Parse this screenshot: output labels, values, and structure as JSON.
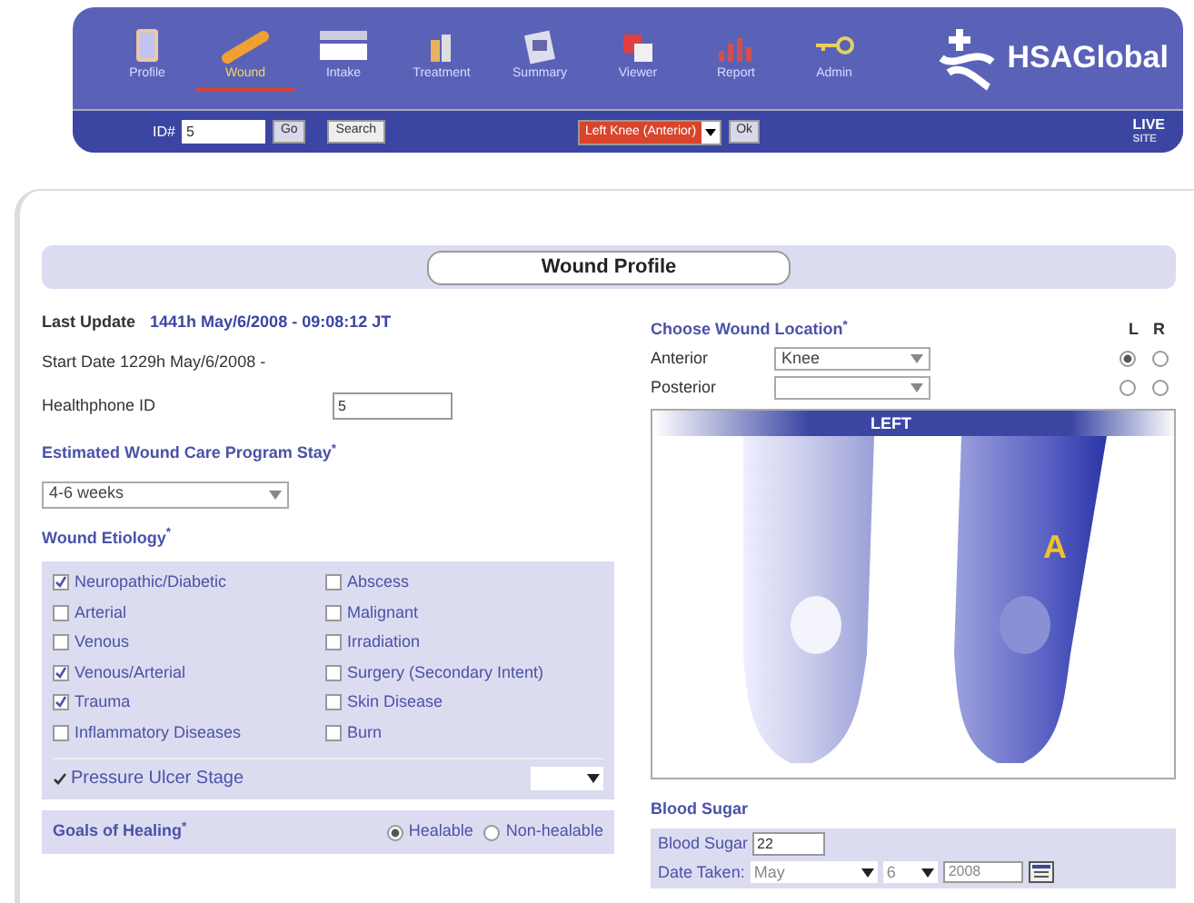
{
  "nav": {
    "items": [
      {
        "label": "Profile",
        "selected": false
      },
      {
        "label": "Wound",
        "selected": true
      },
      {
        "label": "Intake",
        "selected": false
      },
      {
        "label": "Treatment",
        "selected": false
      },
      {
        "label": "Summary",
        "selected": false
      },
      {
        "label": "Viewer",
        "selected": false
      },
      {
        "label": "Report",
        "selected": false
      },
      {
        "label": "Admin",
        "selected": false
      }
    ],
    "brand": "HSAGlobal"
  },
  "toolbar": {
    "id_label": "ID#",
    "id_value": "5",
    "go": "Go",
    "search": "Search",
    "location": "Left Knee (Anterior)",
    "ok": "Ok",
    "site_badge": [
      "LIVE",
      "SITE"
    ]
  },
  "title": "Wound Profile",
  "last_update": {
    "label": "Last Update",
    "value": "1441h May/6/2008 - 09:08:12 JT"
  },
  "start_date": "Start Date 1229h May/6/2008 -",
  "healthphone": {
    "label": "Healthphone ID",
    "value": "5"
  },
  "program_stay": {
    "label": "Estimated Wound Care Program Stay$^{*}$",
    "value": "4-6 weeks"
  },
  "etiology": {
    "label": "Wound Etiology$^{*}$",
    "items": [
      {
        "label": "Neuropathic/Diabetic",
        "checked": true
      },
      {
        "label": "Abscess",
        "checked": false
      },
      {
        "label": "Arterial",
        "checked": false
      },
      {
        "label": "Malignant",
        "checked": false
      },
      {
        "label": "Venous",
        "checked": false
      },
      {
        "label": "Irradiation",
        "checked": false
      },
      {
        "label": "Venous/Arterial",
        "checked": true
      },
      {
        "label": "Surgery (Secondary Intent)",
        "checked": false
      },
      {
        "label": "Trauma",
        "checked": true
      },
      {
        "label": "Skin Disease",
        "checked": false
      },
      {
        "label": "Inflammatory Diseases",
        "checked": false
      },
      {
        "label": "Burn",
        "checked": false
      }
    ],
    "pressure_ulcer": {
      "label": "Pressure Ulcer Stage",
      "checked": true
    }
  },
  "goals": {
    "label": "Goals of Healing$^{*}$",
    "options": [
      {
        "label": "Healable",
        "selected": true
      },
      {
        "label": "Non-healable",
        "selected": false
      }
    ]
  },
  "location": {
    "label": "Choose Wound Location$^{*}$",
    "side_headers": [
      "L",
      "R"
    ],
    "rows": [
      {
        "label": "Anterior",
        "value": "Knee",
        "left": true,
        "right": false
      },
      {
        "label": "Posterior",
        "left": false,
        "right": false
      }
    ],
    "banner": "LEFT",
    "marker": "A"
  },
  "blood_sugar": {
    "heading": "Blood Sugar",
    "label": "Blood Sugar",
    "value": "22",
    "date_label": "Date Taken:",
    "month": "May",
    "day": "6",
    "year": "2008"
  }
}
